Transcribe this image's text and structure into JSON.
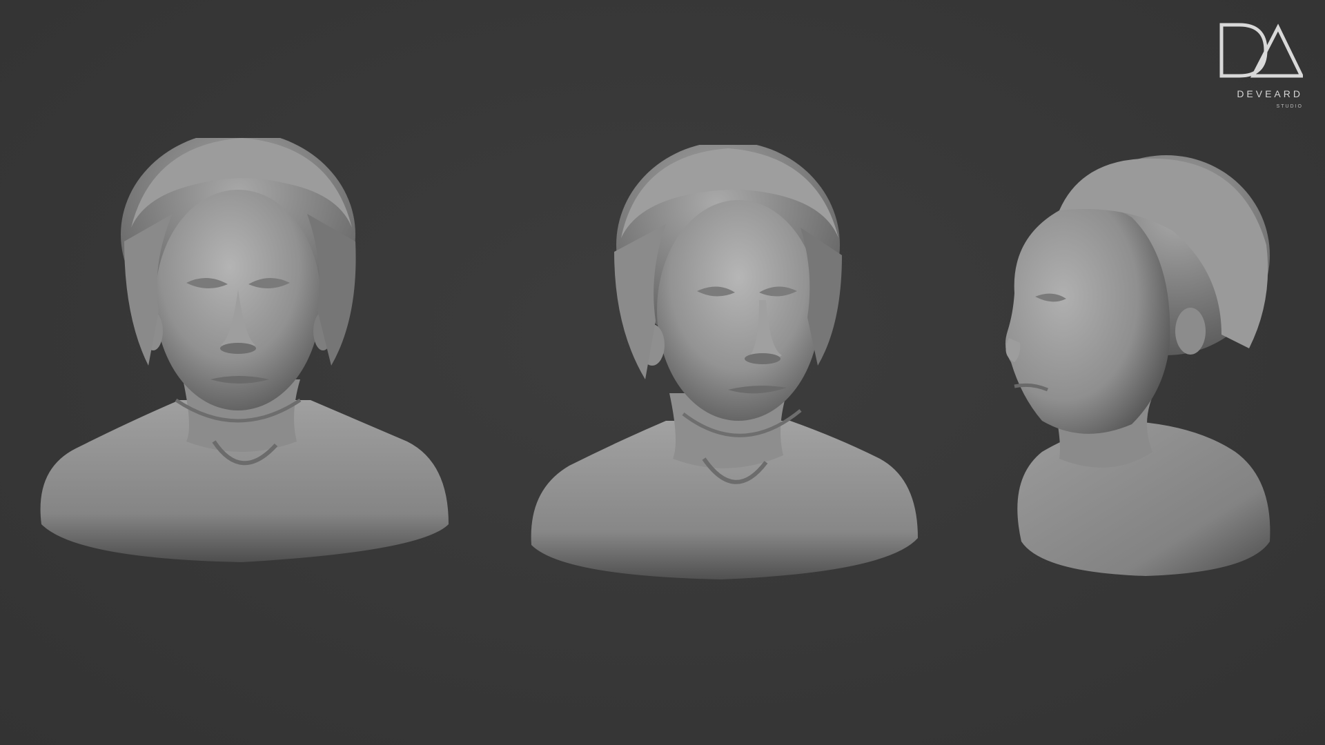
{
  "logo": {
    "name": "DEVEARD",
    "subtitle": "STUDIO",
    "mark_color": "#d9d9d9"
  },
  "colors": {
    "background": "#383838",
    "sculpt_light": "#a9a9a9",
    "sculpt_mid": "#8a8a8a",
    "sculpt_dark": "#4a4a4a"
  },
  "views": [
    {
      "id": "front",
      "label": ""
    },
    {
      "id": "three-quarter",
      "label": ""
    },
    {
      "id": "side",
      "label": ""
    }
  ]
}
